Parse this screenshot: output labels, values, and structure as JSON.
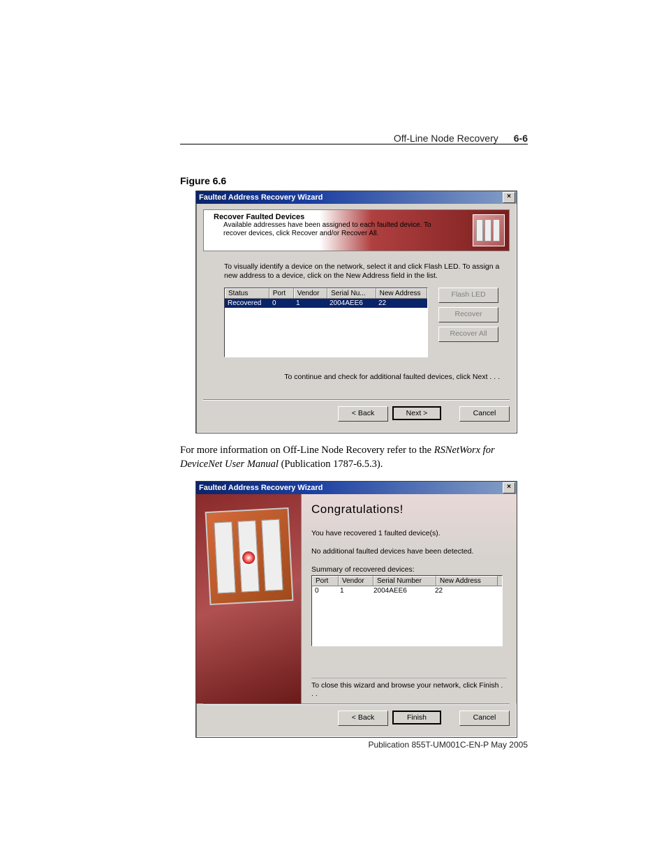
{
  "header": {
    "title": "Off-Line Node Recovery",
    "page": "6-6"
  },
  "figure_label": "Figure 6.6",
  "dialog1": {
    "title": "Faulted Address Recovery Wizard",
    "close": "×",
    "banner_title": "Recover Faulted Devices",
    "banner_body": "Available addresses have been assigned to each faulted device.  To recover devices, click Recover and/or Recover All.",
    "instr": "To visually identify a device on the network, select it and click Flash LED.  To assign a new address to a device, click on the New Address field in the list.",
    "cols": {
      "status": "Status",
      "port": "Port",
      "vendor": "Vendor",
      "serial": "Serial Nu...",
      "newaddr": "New Address"
    },
    "row": {
      "status": "Recovered",
      "port": "0",
      "vendor": "1",
      "serial": "2004AEE6",
      "newaddr": "22"
    },
    "btn_flash": "Flash LED",
    "btn_recover": "Recover",
    "btn_recoverall": "Recover All",
    "note": "To continue and check for additional faulted devices, click Next . . .",
    "back": "< Back",
    "next": "Next >",
    "cancel": "Cancel"
  },
  "midtext": {
    "pre": "For more information on Off-Line Node Recovery refer to the ",
    "ital": "RSNetWorx for DeviceNet User Manual",
    "post": " (Publication 1787-6.5.3)."
  },
  "dialog2": {
    "title": "Faulted Address Recovery Wizard",
    "close": "×",
    "congrats": "Congratulations!",
    "line1": "You have recovered 1 faulted device(s).",
    "line2": "No additional faulted devices have been detected.",
    "summary_label": "Summary of recovered devices:",
    "cols": {
      "port": "Port",
      "vendor": "Vendor",
      "serial": "Serial Number",
      "newaddr": "New Address"
    },
    "row": {
      "port": "0",
      "vendor": "1",
      "serial": "2004AEE6",
      "newaddr": "22"
    },
    "closetxt": "To close this wizard and browse your network, click Finish . . .",
    "back": "< Back",
    "finish": "Finish",
    "cancel": "Cancel"
  },
  "footer": "Publication 855T-UM001C-EN-P  May 2005"
}
